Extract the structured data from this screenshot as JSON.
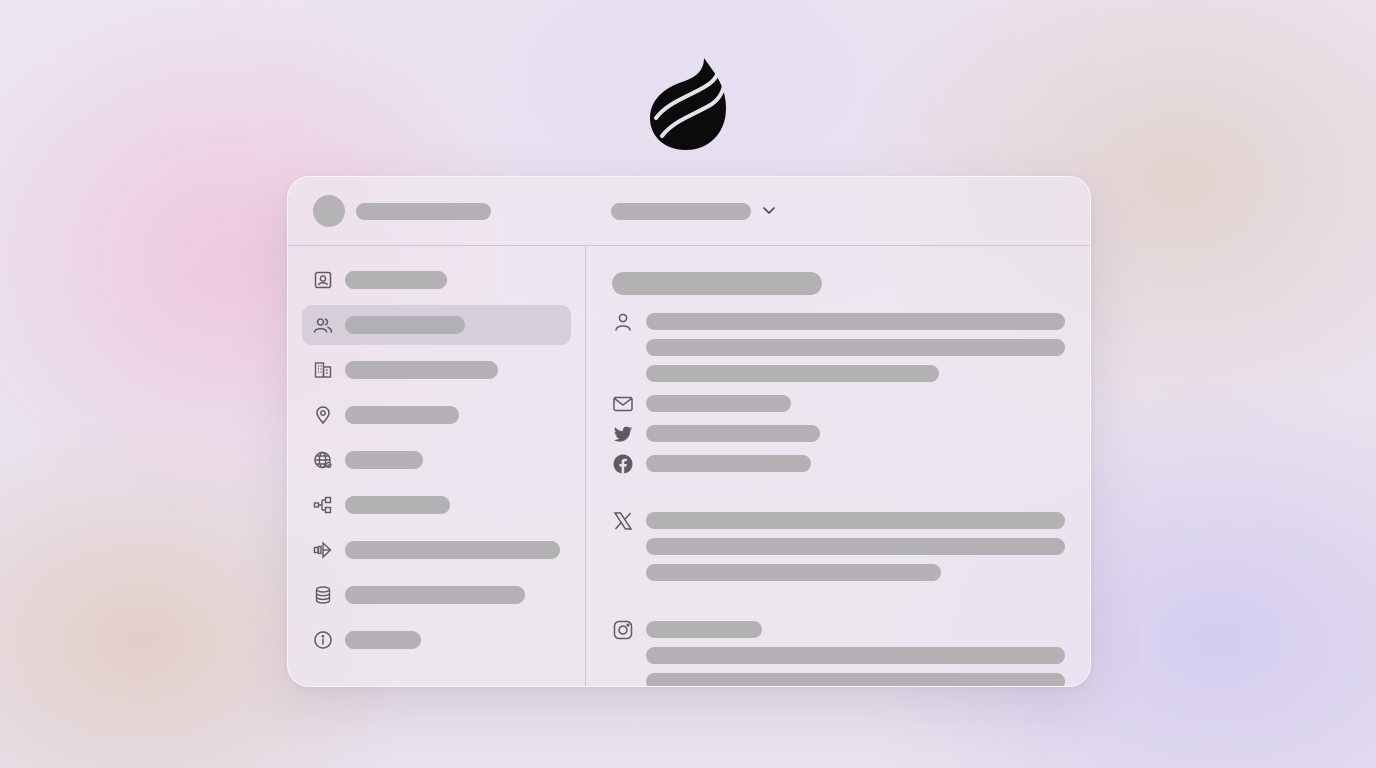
{
  "colors": {
    "placeholder_bar": "#b3b1b4",
    "icon_stroke": "#5f5a62",
    "logo": "#0b0b0c",
    "active_nav_bg": "#d2cdd8"
  },
  "logo": {
    "icon": "flame-logo-icon"
  },
  "header": {
    "avatar": "avatar",
    "dropdown_icon": "chevron-down-icon"
  },
  "sidebar": {
    "items": [
      {
        "icon": "contact-card-icon",
        "active": false
      },
      {
        "icon": "users-icon",
        "active": true
      },
      {
        "icon": "building-icon",
        "active": false
      },
      {
        "icon": "map-pin-icon",
        "active": false
      },
      {
        "icon": "globe-icon",
        "active": false
      },
      {
        "icon": "hierarchy-icon",
        "active": false
      },
      {
        "icon": "tech-stack-icon",
        "active": false
      },
      {
        "icon": "database-icon",
        "active": false
      },
      {
        "icon": "info-icon",
        "active": false
      }
    ]
  },
  "content": {
    "sections": [
      {
        "icon": "person-icon"
      },
      {
        "icon": "mail-icon"
      },
      {
        "icon": "twitter-bird-icon"
      },
      {
        "icon": "facebook-icon"
      },
      {
        "icon": "x-logo-icon"
      },
      {
        "icon": "instagram-icon"
      }
    ]
  }
}
